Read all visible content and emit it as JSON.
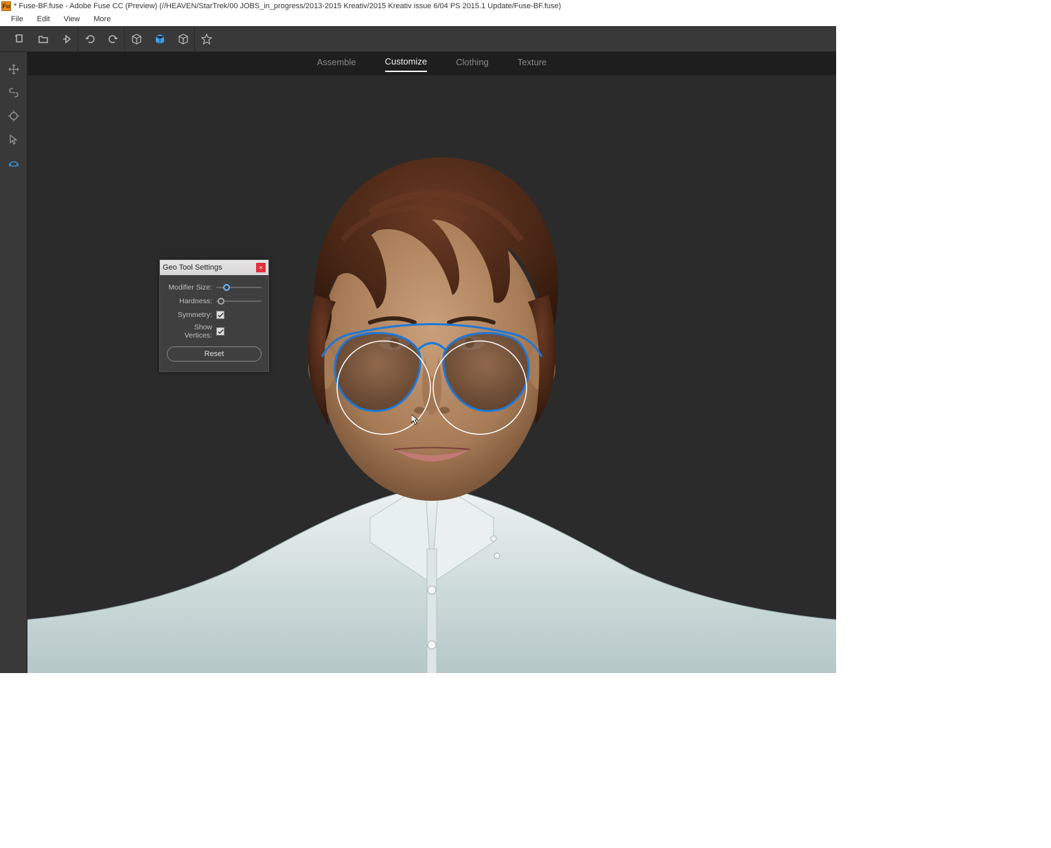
{
  "titlebar": {
    "text": "* Fuse-BF.fuse - Adobe Fuse CC (Preview) (//HEAVEN/StarTrek/00 JOBS_in_progress/2013-2015 Kreativ/2015 Kreativ issue 6/04 PS 2015.1 Update/Fuse-BF.fuse)"
  },
  "menubar": [
    "File",
    "Edit",
    "View",
    "More"
  ],
  "tabs": [
    {
      "label": "Assemble",
      "active": false
    },
    {
      "label": "Customize",
      "active": true
    },
    {
      "label": "Clothing",
      "active": false
    },
    {
      "label": "Texture",
      "active": false
    }
  ],
  "panel": {
    "title": "Geo Tool Settings",
    "modifier_size_label": "Modifier Size:",
    "hardness_label": "Hardness:",
    "modifier_size_value": 22,
    "hardness_value": 10,
    "symmetry_label": "Symmetry:",
    "show_vertices_label": "Show Vertices:",
    "symmetry_checked": true,
    "show_vertices_checked": true,
    "reset_label": "Reset"
  },
  "colors": {
    "accent_blue": "#3aa0f0",
    "panel_bg": "#3f3f3f",
    "viewport_bg": "#2b2b2b",
    "close_red": "#e03040"
  }
}
